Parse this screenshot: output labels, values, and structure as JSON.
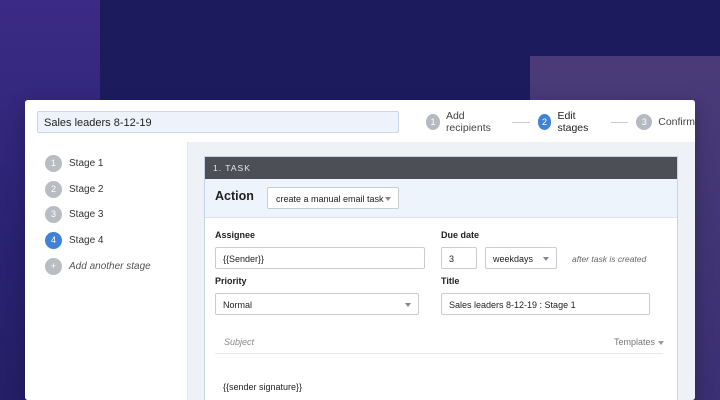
{
  "campaign_name": "Sales leaders 8-12-19",
  "steps": [
    {
      "num": "1",
      "label": "Add recipients"
    },
    {
      "num": "2",
      "label": "Edit stages"
    },
    {
      "num": "3",
      "label": "Confirm"
    }
  ],
  "active_step": "2",
  "stages": [
    {
      "num": "1",
      "label": "Stage 1"
    },
    {
      "num": "2",
      "label": "Stage 2"
    },
    {
      "num": "3",
      "label": "Stage 3"
    },
    {
      "num": "4",
      "label": "Stage 4"
    }
  ],
  "active_stage": "4",
  "add_stage": {
    "icon": "+",
    "label": "Add another stage"
  },
  "task": {
    "header": "1. TASK",
    "action_label": "Action",
    "action_value": "create a manual email task",
    "assignee_label": "Assignee",
    "assignee_value": "{{Sender}}",
    "due_date_label": "Due date",
    "due_date_value": "3",
    "due_date_unit": "weekdays",
    "due_date_hint": "after task is created",
    "priority_label": "Priority",
    "priority_value": "Normal",
    "title_label": "Title",
    "title_value": "Sales leaders 8-12-19 : Stage 1",
    "subject_placeholder": "Subject",
    "templates_label": "Templates",
    "body": "{{sender signature}}"
  },
  "colors": {
    "accent": "#3f82d6",
    "background": "#1c1b5e",
    "task_header": "#4c4f55"
  }
}
